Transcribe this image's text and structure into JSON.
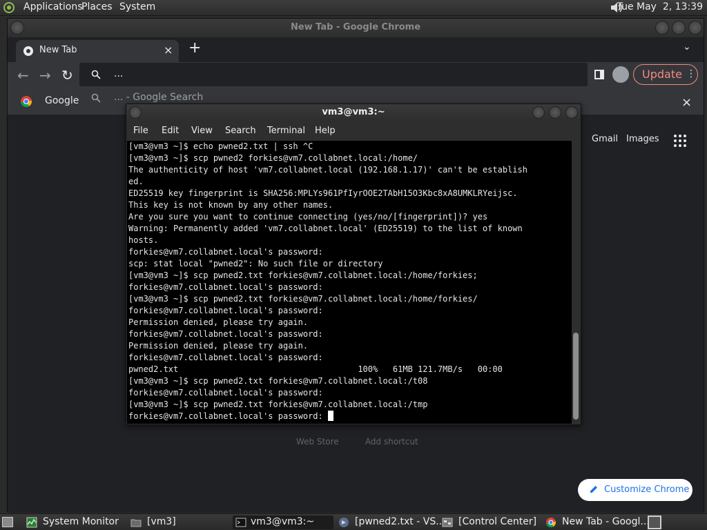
{
  "top_panel": {
    "menus": [
      "Applications",
      "Places",
      "System"
    ],
    "clock": "Tue May  2, 13:39"
  },
  "chrome": {
    "window_title": "New Tab - Google Chrome",
    "tab_label": "New Tab",
    "tab_close": "×",
    "new_tab": "+",
    "tab_search": "⌄",
    "omnibox_text": "...",
    "omnibox_suggestion": "... - Google Search",
    "update_label": "Update",
    "update_menu": "⋮",
    "bookmark_label": "Google",
    "ntp_close": "×",
    "ntp_links": {
      "gmail": "Gmail",
      "images": "Images"
    },
    "customize_label": "Customize Chrome",
    "ntp_hidden_text": "Web Store          Add shortcut",
    "accent": "#1a73e8",
    "update_color": "#f28b82"
  },
  "terminal": {
    "title": "vm3@vm3:~",
    "menus": [
      "File",
      "Edit",
      "View",
      "Search",
      "Terminal",
      "Help"
    ],
    "lines": [
      "[vm3@vm3 ~]$ echo pwned2.txt | ssh ^C",
      "[vm3@vm3 ~]$ scp pwned2 forkies@vm7.collabnet.local:/home/",
      "The authenticity of host 'vm7.collabnet.local (192.168.1.17)' can't be establish",
      "ed.",
      "ED25519 key fingerprint is SHA256:MPLYs961PfIyrOOE2TAbH15O3Kbc8xA8UMKLRYeijsc.",
      "This key is not known by any other names.",
      "Are you sure you want to continue connecting (yes/no/[fingerprint])? yes",
      "Warning: Permanently added 'vm7.collabnet.local' (ED25519) to the list of known",
      "hosts.",
      "forkies@vm7.collabnet.local's password:",
      "scp: stat local \"pwned2\": No such file or directory",
      "[vm3@vm3 ~]$ scp pwned2.txt forkies@vm7.collabnet.local:/home/forkies;",
      "forkies@vm7.collabnet.local's password:",
      "[vm3@vm3 ~]$ scp pwned2.txt forkies@vm7.collabnet.local:/home/forkies/",
      "forkies@vm7.collabnet.local's password:",
      "Permission denied, please try again.",
      "forkies@vm7.collabnet.local's password:",
      "Permission denied, please try again.",
      "forkies@vm7.collabnet.local's password:",
      "pwned2.txt                                    100%   61MB 121.7MB/s   00:00",
      "[vm3@vm3 ~]$ scp pwned2.txt forkies@vm7.collabnet.local:/t08",
      "forkies@vm7.collabnet.local's password:",
      "[vm3@vm3 ~]$ scp pwned2.txt forkies@vm7.collabnet.local:/tmp"
    ],
    "prompt_line": "forkies@vm7.collabnet.local's password: "
  },
  "taskbar": {
    "tasks": [
      {
        "label": "System Monitor",
        "icon": "system-monitor-icon"
      },
      {
        "label": "[vm3]",
        "icon": "folder-icon"
      },
      {
        "label": "vm3@vm3:~",
        "icon": "terminal-icon"
      },
      {
        "label": "[pwned2.txt - VS...",
        "icon": "vscode-icon"
      },
      {
        "label": "[Control Center]",
        "icon": "control-center-icon"
      },
      {
        "label": "New Tab - Googl...",
        "icon": "chrome-icon"
      }
    ]
  }
}
